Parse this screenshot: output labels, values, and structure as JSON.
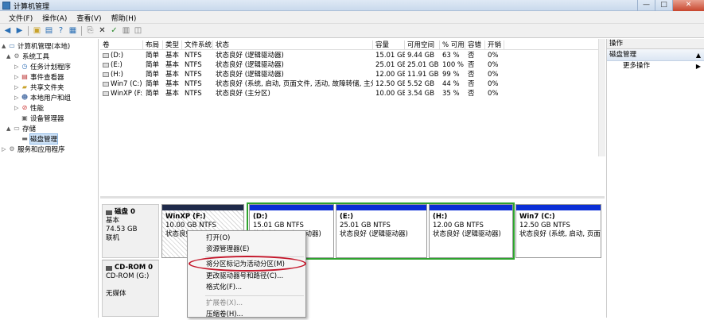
{
  "window": {
    "title": "计算机管理",
    "min": "—",
    "max": "□",
    "close": "✕"
  },
  "menu": [
    "文件(F)",
    "操作(A)",
    "查看(V)",
    "帮助(H)"
  ],
  "toolbar_icons": [
    "back-icon",
    "forward-icon",
    "up-folder-icon",
    "properties-icon",
    "help-icon",
    "refresh-icon",
    "export-icon",
    "close-icon",
    "check-icon",
    "properties-sheet-icon",
    "disk-icon"
  ],
  "tree": [
    {
      "label": "计算机管理(本地)",
      "icon": "computer-icon",
      "level": 0,
      "arrow": "▲"
    },
    {
      "label": "系统工具",
      "icon": "tools-icon",
      "level": 1,
      "arrow": "▲"
    },
    {
      "label": "任务计划程序",
      "icon": "clock-icon",
      "level": 2,
      "arrow": "▷"
    },
    {
      "label": "事件查看器",
      "icon": "event-viewer-icon",
      "level": 2,
      "arrow": "▷"
    },
    {
      "label": "共享文件夹",
      "icon": "shared-folder-icon",
      "level": 2,
      "arrow": "▷"
    },
    {
      "label": "本地用户和组",
      "icon": "users-icon",
      "level": 2,
      "arrow": "▷"
    },
    {
      "label": "性能",
      "icon": "performance-icon",
      "level": 2,
      "arrow": "▷"
    },
    {
      "label": "设备管理器",
      "icon": "device-manager-icon",
      "level": 2,
      "arrow": ""
    },
    {
      "label": "存储",
      "icon": "storage-icon",
      "level": 1,
      "arrow": "▲"
    },
    {
      "label": "磁盘管理",
      "icon": "disk-management-icon",
      "level": 2,
      "arrow": "",
      "selected": true
    },
    {
      "label": "服务和应用程序",
      "icon": "services-icon",
      "level": 1,
      "arrow": "▷"
    }
  ],
  "volume_table": {
    "headers": [
      "卷",
      "布局",
      "类型",
      "文件系统",
      "状态",
      "容量",
      "可用空间",
      "% 可用",
      "容错",
      "开销"
    ],
    "rows": [
      [
        "(D:)",
        "简单",
        "基本",
        "NTFS",
        "状态良好 (逻辑驱动器)",
        "15.01 GB",
        "9.44 GB",
        "63 %",
        "否",
        "0%"
      ],
      [
        "(E:)",
        "简单",
        "基本",
        "NTFS",
        "状态良好 (逻辑驱动器)",
        "25.01 GB",
        "25.01 GB",
        "100 %",
        "否",
        "0%"
      ],
      [
        "(H:)",
        "简单",
        "基本",
        "NTFS",
        "状态良好 (逻辑驱动器)",
        "12.00 GB",
        "11.91 GB",
        "99 %",
        "否",
        "0%"
      ],
      [
        "Win7 (C:)",
        "简单",
        "基本",
        "NTFS",
        "状态良好 (系统, 启动, 页面文件, 活动, 故障转储, 主分区)",
        "12.50 GB",
        "5.52 GB",
        "44 %",
        "否",
        "0%"
      ],
      [
        "WinXP (F:)",
        "简单",
        "基本",
        "NTFS",
        "状态良好 (主分区)",
        "10.00 GB",
        "3.54 GB",
        "35 %",
        "否",
        "0%"
      ]
    ]
  },
  "disks": [
    {
      "name": "磁盘 0",
      "type": "基本",
      "size": "74.53 GB",
      "status": "联机"
    },
    {
      "name": "CD-ROM 0",
      "type": "CD-ROM (G:)",
      "size": "",
      "status": "无媒体"
    }
  ],
  "partitions": [
    {
      "name": "WinXP  (F:)",
      "size": "10.00 GB NTFS",
      "status": "状态良好"
    },
    {
      "name": "(D:)",
      "size": "15.01 GB NTFS",
      "status": "状态良好 (逻辑驱动器)"
    },
    {
      "name": "(E:)",
      "size": "25.01 GB NTFS",
      "status": "状态良好 (逻辑驱动器)"
    },
    {
      "name": "(H:)",
      "size": "12.00 GB NTFS",
      "status": "状态良好 (逻辑驱动器)"
    },
    {
      "name": "Win7  (C:)",
      "size": "12.50 GB NTFS",
      "status": "状态良好 (系统, 启动, 页面文"
    }
  ],
  "context_menu": [
    {
      "label": "打开(O)",
      "disabled": false
    },
    {
      "label": "资源管理器(E)",
      "disabled": false
    },
    {
      "label": "将分区标记为活动分区(M)",
      "disabled": false
    },
    {
      "label": "更改驱动器号和路径(C)...",
      "disabled": false
    },
    {
      "label": "格式化(F)...",
      "disabled": false
    },
    {
      "label": "扩展卷(X)...",
      "disabled": true
    },
    {
      "label": "压缩卷(H)...",
      "disabled": false
    }
  ],
  "actions": {
    "header": "操作",
    "section": "磁盘管理",
    "section_arrow": "▲",
    "item": "更多操作",
    "item_arrow": "▶"
  },
  "colors": {
    "primary_bar": "#0a2fd6",
    "extended_border": "#2ea32e",
    "highlight_circle": "#c4162a"
  }
}
